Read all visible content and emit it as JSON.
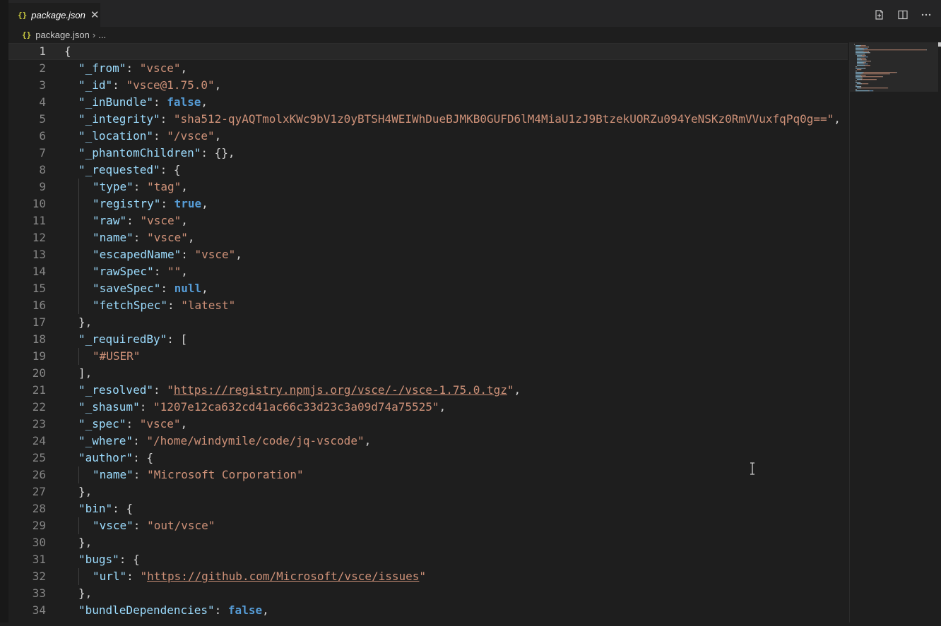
{
  "tab": {
    "icon_text": "{}",
    "label": "package.json"
  },
  "toolbar": {
    "open_changes_icon": "open-changes-icon",
    "split_icon": "split-editor-icon",
    "more_icon": "more-actions-icon"
  },
  "breadcrumb": {
    "icon_text": "{}",
    "file": "package.json",
    "more": "..."
  },
  "colors": {
    "background": "#1e1e1e",
    "key": "#9cdcfe",
    "string": "#ce9178",
    "boolean": "#569cd6",
    "punct": "#d4d4d4",
    "line_number": "#858585"
  },
  "editor": {
    "lines": [
      {
        "n": "1",
        "i": 0,
        "t": [
          [
            "p",
            "{"
          ]
        ]
      },
      {
        "n": "2",
        "i": 1,
        "t": [
          [
            "k",
            "\"_from\""
          ],
          [
            "p",
            ": "
          ],
          [
            "s",
            "\"vsce\""
          ],
          [
            "p",
            ","
          ]
        ]
      },
      {
        "n": "3",
        "i": 1,
        "t": [
          [
            "k",
            "\"_id\""
          ],
          [
            "p",
            ": "
          ],
          [
            "s",
            "\"vsce@1.75.0\""
          ],
          [
            "p",
            ","
          ]
        ]
      },
      {
        "n": "4",
        "i": 1,
        "t": [
          [
            "k",
            "\"_inBundle\""
          ],
          [
            "p",
            ": "
          ],
          [
            "b",
            "false"
          ],
          [
            "p",
            ","
          ]
        ]
      },
      {
        "n": "5",
        "i": 1,
        "t": [
          [
            "k",
            "\"_integrity\""
          ],
          [
            "p",
            ": "
          ],
          [
            "s",
            "\"sha512-qyAQTmolxKWc9bV1z0yBTSH4WEIWhDueBJMKB0GUFD6lM4MiaU1zJ9BtzekUORZu094YeNSKz0RmVVuxfqPq0g==\""
          ],
          [
            "p",
            ","
          ]
        ]
      },
      {
        "n": "6",
        "i": 1,
        "t": [
          [
            "k",
            "\"_location\""
          ],
          [
            "p",
            ": "
          ],
          [
            "s",
            "\"/vsce\""
          ],
          [
            "p",
            ","
          ]
        ]
      },
      {
        "n": "7",
        "i": 1,
        "t": [
          [
            "k",
            "\"_phantomChildren\""
          ],
          [
            "p",
            ": {},"
          ]
        ]
      },
      {
        "n": "8",
        "i": 1,
        "t": [
          [
            "k",
            "\"_requested\""
          ],
          [
            "p",
            ": {"
          ]
        ]
      },
      {
        "n": "9",
        "i": 2,
        "t": [
          [
            "k",
            "\"type\""
          ],
          [
            "p",
            ": "
          ],
          [
            "s",
            "\"tag\""
          ],
          [
            "p",
            ","
          ]
        ]
      },
      {
        "n": "10",
        "i": 2,
        "t": [
          [
            "k",
            "\"registry\""
          ],
          [
            "p",
            ": "
          ],
          [
            "b",
            "true"
          ],
          [
            "p",
            ","
          ]
        ]
      },
      {
        "n": "11",
        "i": 2,
        "t": [
          [
            "k",
            "\"raw\""
          ],
          [
            "p",
            ": "
          ],
          [
            "s",
            "\"vsce\""
          ],
          [
            "p",
            ","
          ]
        ]
      },
      {
        "n": "12",
        "i": 2,
        "t": [
          [
            "k",
            "\"name\""
          ],
          [
            "p",
            ": "
          ],
          [
            "s",
            "\"vsce\""
          ],
          [
            "p",
            ","
          ]
        ]
      },
      {
        "n": "13",
        "i": 2,
        "t": [
          [
            "k",
            "\"escapedName\""
          ],
          [
            "p",
            ": "
          ],
          [
            "s",
            "\"vsce\""
          ],
          [
            "p",
            ","
          ]
        ]
      },
      {
        "n": "14",
        "i": 2,
        "t": [
          [
            "k",
            "\"rawSpec\""
          ],
          [
            "p",
            ": "
          ],
          [
            "s",
            "\"\""
          ],
          [
            "p",
            ","
          ]
        ]
      },
      {
        "n": "15",
        "i": 2,
        "t": [
          [
            "k",
            "\"saveSpec\""
          ],
          [
            "p",
            ": "
          ],
          [
            "b",
            "null"
          ],
          [
            "p",
            ","
          ]
        ]
      },
      {
        "n": "16",
        "i": 2,
        "t": [
          [
            "k",
            "\"fetchSpec\""
          ],
          [
            "p",
            ": "
          ],
          [
            "s",
            "\"latest\""
          ]
        ]
      },
      {
        "n": "17",
        "i": 1,
        "t": [
          [
            "p",
            "},"
          ]
        ]
      },
      {
        "n": "18",
        "i": 1,
        "t": [
          [
            "k",
            "\"_requiredBy\""
          ],
          [
            "p",
            ": ["
          ]
        ]
      },
      {
        "n": "19",
        "i": 2,
        "t": [
          [
            "s",
            "\"#USER\""
          ]
        ]
      },
      {
        "n": "20",
        "i": 1,
        "t": [
          [
            "p",
            "],"
          ]
        ]
      },
      {
        "n": "21",
        "i": 1,
        "t": [
          [
            "k",
            "\"_resolved\""
          ],
          [
            "p",
            ": "
          ],
          [
            "s",
            "\""
          ],
          [
            "u",
            "https://registry.npmjs.org/vsce/-/vsce-1.75.0.tgz"
          ],
          [
            "s",
            "\""
          ],
          [
            "p",
            ","
          ]
        ]
      },
      {
        "n": "22",
        "i": 1,
        "t": [
          [
            "k",
            "\"_shasum\""
          ],
          [
            "p",
            ": "
          ],
          [
            "s",
            "\"1207e12ca632cd41ac66c33d23c3a09d74a75525\""
          ],
          [
            "p",
            ","
          ]
        ]
      },
      {
        "n": "23",
        "i": 1,
        "t": [
          [
            "k",
            "\"_spec\""
          ],
          [
            "p",
            ": "
          ],
          [
            "s",
            "\"vsce\""
          ],
          [
            "p",
            ","
          ]
        ]
      },
      {
        "n": "24",
        "i": 1,
        "t": [
          [
            "k",
            "\"_where\""
          ],
          [
            "p",
            ": "
          ],
          [
            "s",
            "\"/home/windymile/code/jq-vscode\""
          ],
          [
            "p",
            ","
          ]
        ]
      },
      {
        "n": "25",
        "i": 1,
        "t": [
          [
            "k",
            "\"author\""
          ],
          [
            "p",
            ": {"
          ]
        ]
      },
      {
        "n": "26",
        "i": 2,
        "t": [
          [
            "k",
            "\"name\""
          ],
          [
            "p",
            ": "
          ],
          [
            "s",
            "\"Microsoft Corporation\""
          ]
        ]
      },
      {
        "n": "27",
        "i": 1,
        "t": [
          [
            "p",
            "},"
          ]
        ]
      },
      {
        "n": "28",
        "i": 1,
        "t": [
          [
            "k",
            "\"bin\""
          ],
          [
            "p",
            ": {"
          ]
        ]
      },
      {
        "n": "29",
        "i": 2,
        "t": [
          [
            "k",
            "\"vsce\""
          ],
          [
            "p",
            ": "
          ],
          [
            "s",
            "\"out/vsce\""
          ]
        ]
      },
      {
        "n": "30",
        "i": 1,
        "t": [
          [
            "p",
            "},"
          ]
        ]
      },
      {
        "n": "31",
        "i": 1,
        "t": [
          [
            "k",
            "\"bugs\""
          ],
          [
            "p",
            ": {"
          ]
        ]
      },
      {
        "n": "32",
        "i": 2,
        "t": [
          [
            "k",
            "\"url\""
          ],
          [
            "p",
            ": "
          ],
          [
            "s",
            "\""
          ],
          [
            "u",
            "https://github.com/Microsoft/vsce/issues"
          ],
          [
            "s",
            "\""
          ]
        ]
      },
      {
        "n": "33",
        "i": 1,
        "t": [
          [
            "p",
            "},"
          ]
        ]
      },
      {
        "n": "34",
        "i": 1,
        "t": [
          [
            "k",
            "\"bundleDependencies\""
          ],
          [
            "p",
            ": "
          ],
          [
            "b",
            "false"
          ],
          [
            "p",
            ","
          ]
        ]
      }
    ]
  }
}
